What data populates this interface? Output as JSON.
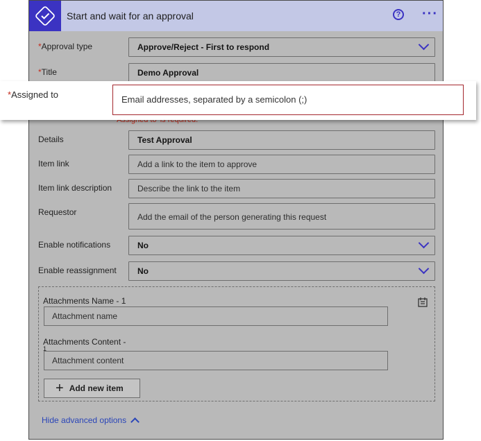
{
  "header": {
    "title": "Start and wait for an approval",
    "help_glyph": "?",
    "more_glyph": "···"
  },
  "fields": {
    "approval_type": {
      "label": "Approval type",
      "value": "Approve/Reject - First to respond"
    },
    "title": {
      "label": "Title",
      "value": "Demo Approval"
    },
    "assigned_to": {
      "label": "Assigned to",
      "placeholder": "Email addresses, separated by a semicolon (;)",
      "error": "'Assigned to' is required."
    },
    "details": {
      "label": "Details",
      "value": "Test Approval"
    },
    "item_link": {
      "label": "Item link",
      "placeholder": "Add a link to the item to approve"
    },
    "item_link_description": {
      "label": "Item link description",
      "placeholder": "Describe the link to the item"
    },
    "requestor": {
      "label": "Requestor",
      "placeholder": "Add the email of the person generating this request"
    },
    "enable_notifications": {
      "label": "Enable notifications",
      "value": "No"
    },
    "enable_reassignment": {
      "label": "Enable reassignment",
      "value": "No"
    }
  },
  "required_marker": "*",
  "attachments": {
    "name_label": "Attachments Name - 1",
    "name_placeholder": "Attachment name",
    "content_label": "Attachments Content -",
    "content_label_2": "1",
    "content_placeholder": "Attachment content",
    "add_button": "Add new item",
    "add_glyph": "+"
  },
  "hide_advanced": "Hide advanced options",
  "colors": {
    "accent": "#3b33c2",
    "header_bg": "#c3c8e6",
    "error": "#c42b1c",
    "link": "#2a45b8"
  }
}
